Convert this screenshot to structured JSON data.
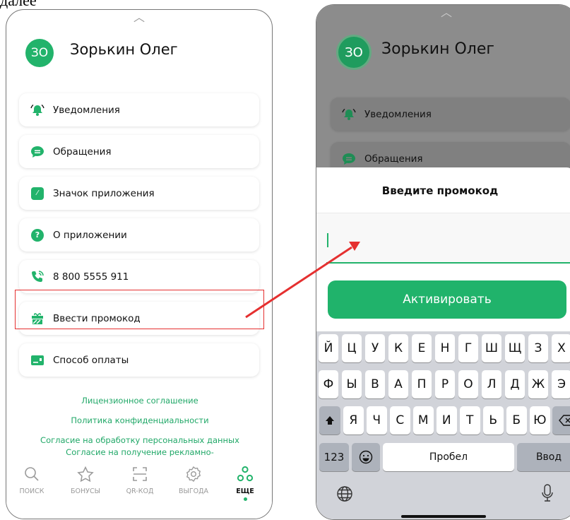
{
  "top_fragment": "далее",
  "left_screen": {
    "avatar_initials": "ЗО",
    "user_name": "Зорькин Олег",
    "menu": [
      {
        "label": "Уведомления",
        "icon": "bell-icon"
      },
      {
        "label": "Обращения",
        "icon": "chat-bubble-icon"
      },
      {
        "label": "Значок приложения",
        "icon": "app-badge-icon"
      },
      {
        "label": "О приложении",
        "icon": "question-icon"
      },
      {
        "label": "8 800 5555 911",
        "icon": "phone-icon"
      },
      {
        "label": "Ввести промокод",
        "icon": "gift-icon"
      },
      {
        "label": "Способ оплаты",
        "icon": "card-icon"
      }
    ],
    "links": [
      "Лицензионное соглашение",
      "Политика конфиденциальности",
      "Согласие на обработку персональных данных",
      "Согласие на получение рекламно-"
    ],
    "tabs": [
      {
        "label": "ПОИСК",
        "icon": "search-icon"
      },
      {
        "label": "БОНУСЫ",
        "icon": "star-icon"
      },
      {
        "label": "QR-КОД",
        "icon": "qr-scan-icon"
      },
      {
        "label": "ВЫГОДА",
        "icon": "gear-icon"
      },
      {
        "label": "ЕЩЕ",
        "icon": "more-icon",
        "active": true
      }
    ]
  },
  "right_screen": {
    "avatar_initials": "ЗО",
    "user_name": "Зорькин Олег",
    "menu": [
      {
        "label": "Уведомления",
        "icon": "bell-icon"
      },
      {
        "label": "Обращения",
        "icon": "chat-bubble-icon"
      }
    ],
    "sheet_title": "Введите промокод",
    "promo_value": "",
    "promo_placeholder": "",
    "activate_label": "Активировать",
    "keyboard": {
      "row1": [
        "Й",
        "Ц",
        "У",
        "К",
        "Е",
        "Н",
        "Г",
        "Ш",
        "Щ",
        "З",
        "Х"
      ],
      "row2": [
        "Ф",
        "Ы",
        "В",
        "А",
        "П",
        "Р",
        "О",
        "Л",
        "Д",
        "Ж",
        "Э"
      ],
      "row3": [
        "Я",
        "Ч",
        "С",
        "М",
        "И",
        "Т",
        "Ь",
        "Б",
        "Ю"
      ],
      "numbers_key": "123",
      "space_key": "Пробел",
      "return_key": "Ввод"
    }
  },
  "colors": {
    "brand_green": "#22b36b",
    "highlight_red": "#e53030"
  }
}
